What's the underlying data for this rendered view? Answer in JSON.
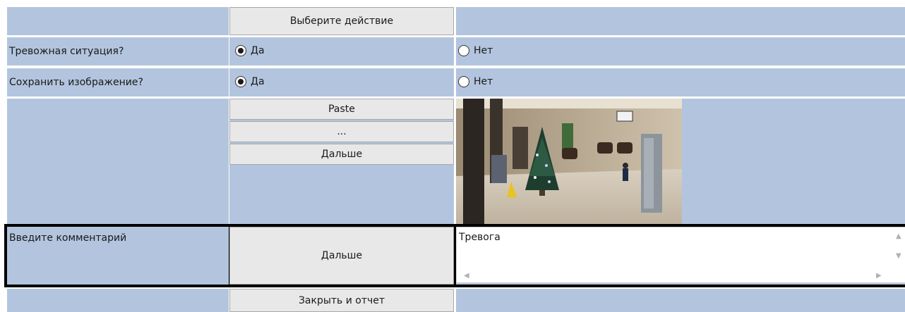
{
  "row_action": {
    "button_label": "Выберите действие"
  },
  "row_alarm": {
    "label": "Тревожная ситуация?",
    "yes": "Да",
    "no": "Нет",
    "selected": "yes"
  },
  "row_save": {
    "label": "Сохранить изображение?",
    "yes": "Да",
    "no": "Нет",
    "selected": "yes"
  },
  "image_row": {
    "paste_label": "Paste",
    "browse_label": "...",
    "next_label": "Дальше"
  },
  "comment_row": {
    "label": "Введите комментарий",
    "next_label": "Дальше",
    "value": "Тревога",
    "scroll_icons": [
      "chevron-up-icon",
      "chevron-down-icon",
      "chevron-left-icon",
      "chevron-right-icon"
    ]
  },
  "bottom_row": {
    "close_label": "Закрыть и отчет"
  },
  "colors": {
    "panel": "#b3c5de",
    "button": "#e8e8e8",
    "highlight_border": "#000000"
  }
}
